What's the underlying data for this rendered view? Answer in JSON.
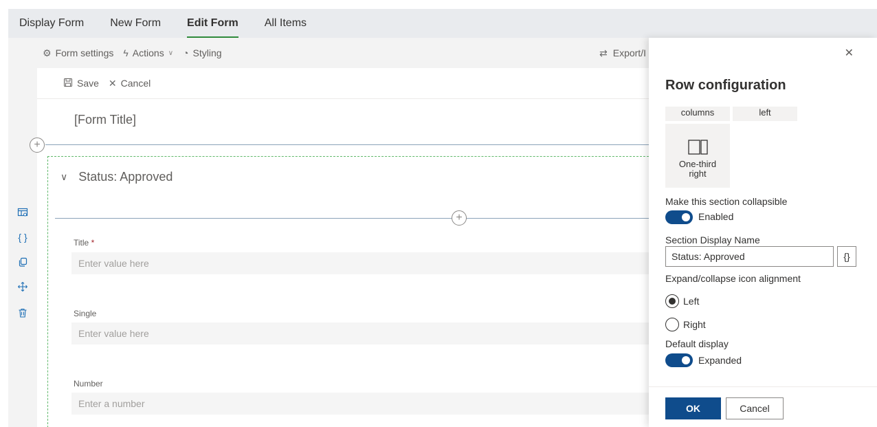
{
  "tabs": [
    "Display Form",
    "New Form",
    "Edit Form",
    "All Items"
  ],
  "active_tab": "Edit Form",
  "toolbar": {
    "form_settings": "Form settings",
    "actions": "Actions",
    "styling": "Styling",
    "export": "Export/I"
  },
  "savebar": {
    "save": "Save",
    "cancel": "Cancel"
  },
  "form": {
    "title": "[Form Title]",
    "section_name": "Status: Approved",
    "fields": [
      {
        "label": "Title",
        "required": "*",
        "placeholder": "Enter value here"
      },
      {
        "label": "Single",
        "placeholder": "Enter value here"
      },
      {
        "label": "Number",
        "placeholder": "Enter a number"
      }
    ]
  },
  "panel": {
    "title": "Row configuration",
    "layout_options": {
      "columns": "columns",
      "left": "left",
      "one_third_right_line1": "One-third",
      "one_third_right_line2": "right"
    },
    "collapsible_label": "Make this section collapsible",
    "collapsible_state": "Enabled",
    "display_name_label": "Section Display Name",
    "display_name_value": "Status: Approved",
    "braces": "{}",
    "alignment_label": "Expand/collapse icon alignment",
    "alignment_left": "Left",
    "alignment_right": "Right",
    "default_display_label": "Default display",
    "default_display_state": "Expanded",
    "ok": "OK",
    "cancel": "Cancel"
  },
  "colors": {
    "primary": "#0f4c8c",
    "active_tab_underline": "#2e8a3a",
    "section_border": "#5fb86a",
    "left_icons": "#1e6fb5"
  }
}
